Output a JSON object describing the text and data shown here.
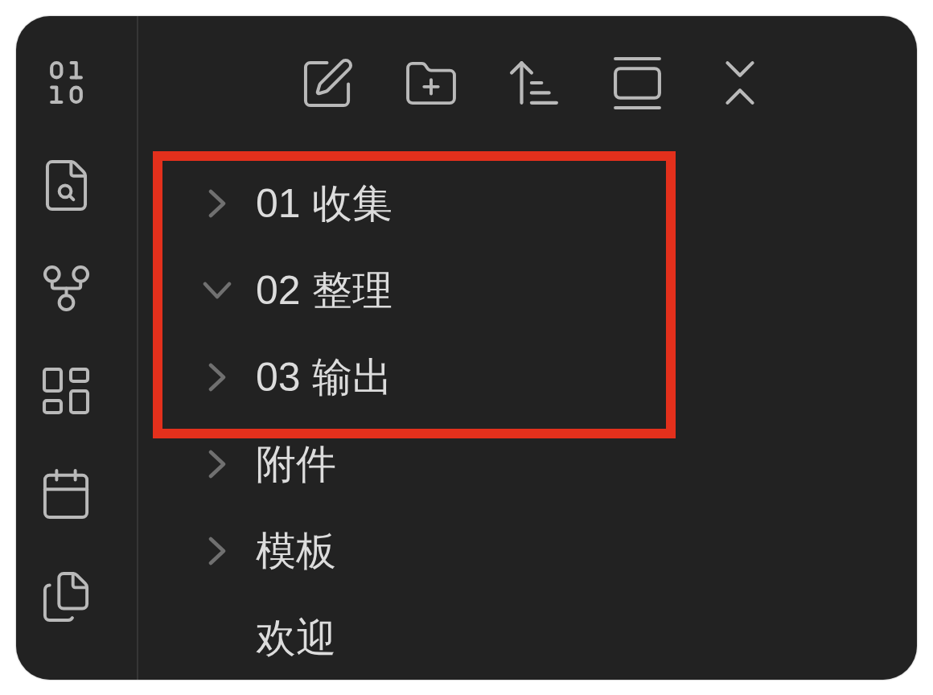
{
  "file_tree": {
    "items": [
      {
        "kind": "folder",
        "label": "01 收集",
        "expanded": false,
        "highlighted": true
      },
      {
        "kind": "folder",
        "label": "02 整理",
        "expanded": true,
        "highlighted": true
      },
      {
        "kind": "folder",
        "label": "03 输出",
        "expanded": false,
        "highlighted": true
      },
      {
        "kind": "folder",
        "label": "附件",
        "expanded": false,
        "highlighted": false
      },
      {
        "kind": "folder",
        "label": "模板",
        "expanded": false,
        "highlighted": false
      },
      {
        "kind": "file",
        "label": "欢迎",
        "highlighted": false
      }
    ]
  }
}
